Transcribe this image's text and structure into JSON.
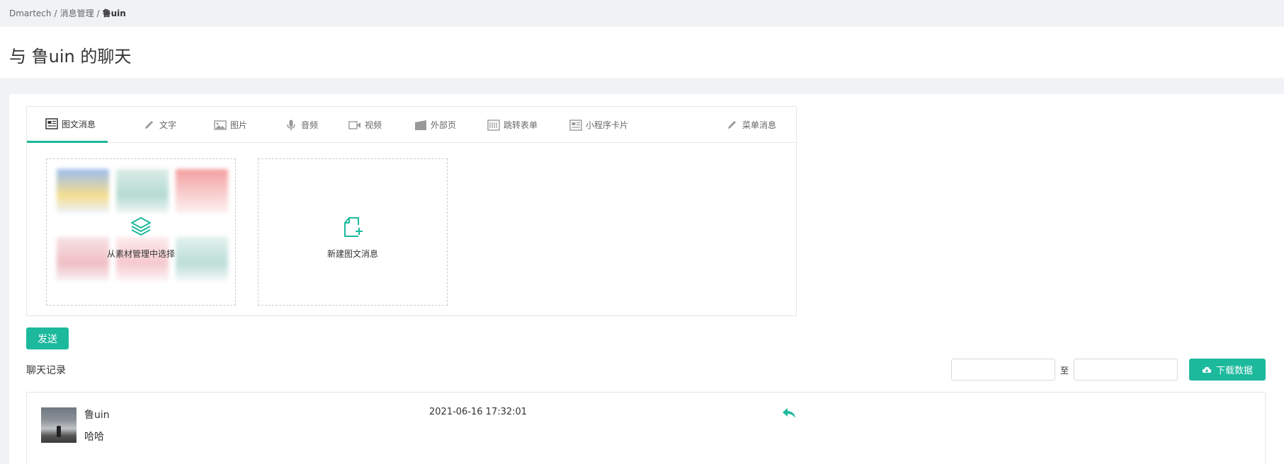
{
  "breadcrumb": {
    "items": [
      "Dmartech",
      "消息管理"
    ],
    "current": "鲁uin",
    "separator": "/"
  },
  "page": {
    "title": "与 鲁uin 的聊天"
  },
  "tabs": [
    {
      "label": "图文消息",
      "icon": "news-icon",
      "active": true
    },
    {
      "label": "文字",
      "icon": "pencil-icon"
    },
    {
      "label": "图片",
      "icon": "image-icon"
    },
    {
      "label": "音频",
      "icon": "microphone-icon"
    },
    {
      "label": "视频",
      "icon": "video-icon"
    },
    {
      "label": "外部页",
      "icon": "external-page-icon"
    },
    {
      "label": "跳转表单",
      "icon": "form-icon"
    },
    {
      "label": "小程序卡片",
      "icon": "mini-program-card-icon"
    },
    {
      "label": "菜单消息",
      "icon": "pencil-icon"
    }
  ],
  "cards": {
    "library": {
      "label": "从素材管理中选择",
      "icon": "layers-icon"
    },
    "create": {
      "label": "新建图文消息",
      "icon": "new-file-icon"
    }
  },
  "send_button": "发送",
  "history": {
    "title": "聊天记录",
    "range_separator": "至",
    "start_value": "",
    "end_value": "",
    "download_label": "下载数据"
  },
  "records": [
    {
      "name": "鲁uin",
      "message": "哈哈",
      "time": "2021-06-16 17:32:01"
    }
  ],
  "colors": {
    "accent": "#1cb99d",
    "page_bg": "#f0f2f5"
  }
}
